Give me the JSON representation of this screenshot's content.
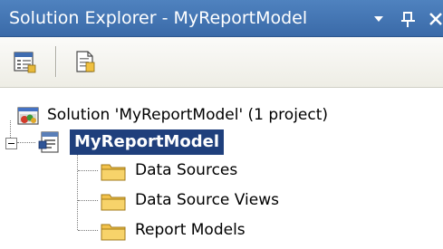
{
  "window": {
    "title": "Solution Explorer - MyReportModel",
    "dropdown_glyph": "▾",
    "pin_glyph": "ꟼ",
    "close_glyph": "X"
  },
  "toolbar": {
    "buttons": [
      {
        "name": "properties",
        "icon": "properties-icon"
      },
      {
        "name": "show-all-files",
        "icon": "page-icon"
      }
    ]
  },
  "tree": {
    "solution": {
      "label": "Solution 'MyReportModel' (1 project)",
      "icon": "solution-icon"
    },
    "project": {
      "label": "MyReportModel",
      "icon": "report-project-icon",
      "expanded": true,
      "selected": true
    },
    "folders": [
      {
        "label": "Data Sources",
        "icon": "folder-icon"
      },
      {
        "label": "Data Source Views",
        "icon": "folder-icon"
      },
      {
        "label": "Report Models",
        "icon": "folder-icon"
      }
    ]
  },
  "colors": {
    "title_bar": "#3f72b3",
    "selection": "#1f3f7c",
    "folder": "#f2c14a"
  }
}
